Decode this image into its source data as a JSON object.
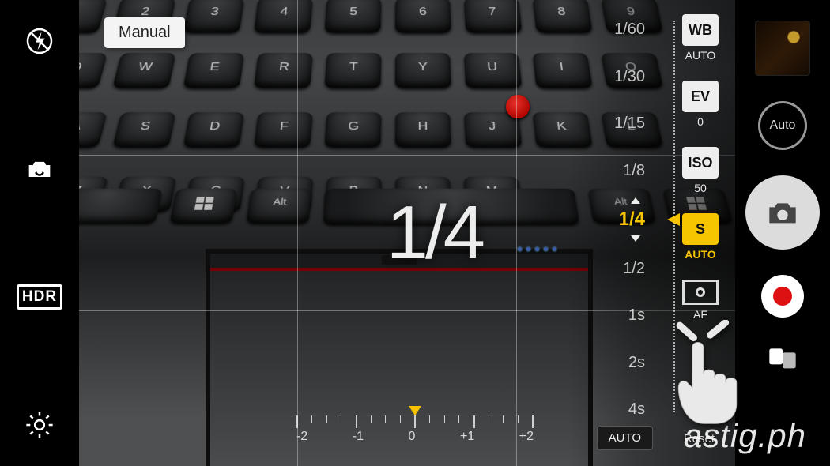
{
  "tooltip": {
    "label": "Manual"
  },
  "leftbar": {
    "flash": "flash-off",
    "switch_cam": "switch-camera",
    "hdr": "HDR",
    "settings": "settings"
  },
  "rightbar": {
    "mode_label": "Auto"
  },
  "params": {
    "wb": {
      "box": "WB",
      "sub": "AUTO"
    },
    "ev": {
      "box": "EV",
      "sub": "0"
    },
    "iso": {
      "box": "ISO",
      "sub": "50"
    },
    "s": {
      "box": "S",
      "sub": "AUTO",
      "selected": true
    },
    "af": {
      "label": "AF"
    }
  },
  "speed": {
    "items": [
      "1/60",
      "1/30",
      "1/15",
      "1/8",
      "1/4",
      "1/2",
      "1s",
      "2s",
      "4s"
    ],
    "selected_index": 4,
    "big_readout": "1/4"
  },
  "ev_scale": {
    "labels": [
      "-2",
      "-1",
      "0",
      "+1",
      "+2"
    ],
    "marker_value": 0
  },
  "bottom": {
    "auto": "AUTO",
    "reset": "Reset"
  },
  "watermark": "astig.ph"
}
